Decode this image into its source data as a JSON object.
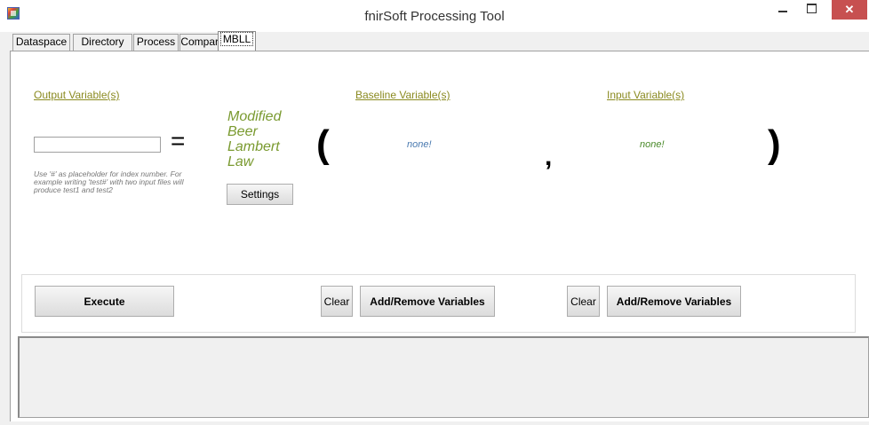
{
  "window": {
    "title": "fnirSoft Processing Tool",
    "close_glyph": "✕"
  },
  "tabs": [
    "Dataspace",
    "Directory",
    "Process",
    "Compare",
    "MBLL"
  ],
  "output": {
    "label": "Output Variable(s)",
    "value": "",
    "equals": "=",
    "hint": "Use '#' as placeholder for index number. For example writing 'test#' with two input files will produce test1 and test2"
  },
  "mbll": {
    "text": "Modified Beer Lambert Law",
    "settings_label": "Settings"
  },
  "symbols": {
    "open_paren": "(",
    "comma": ",",
    "close_paren": ")"
  },
  "baseline": {
    "label": "Baseline Variable(s)",
    "value": "none!",
    "clear_label": "Clear",
    "add_remove_label": "Add/Remove Variables"
  },
  "input": {
    "label": "Input Variable(s)",
    "value": "none!",
    "clear_label": "Clear",
    "add_remove_label": "Add/Remove Variables"
  },
  "execute_label": "Execute",
  "icons": {
    "app": "app-icon",
    "minimize": "minimize-icon",
    "maximize": "maximize-icon",
    "close": "close-icon"
  },
  "colors": {
    "label": "#8a8a20",
    "mbll": "#7a9a30",
    "none_baseline": "#4a7ab0",
    "none_input": "#4a8a2a",
    "close": "#c75050"
  }
}
